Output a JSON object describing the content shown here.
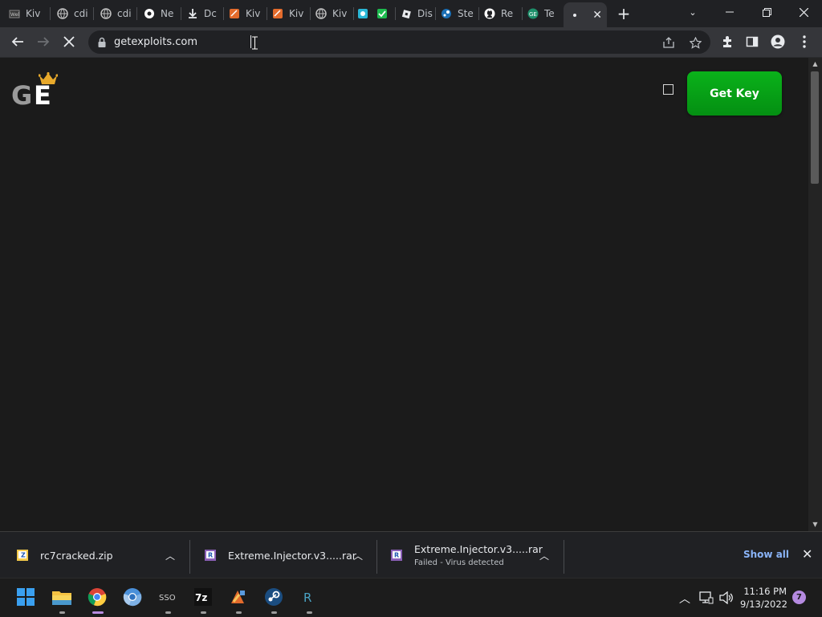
{
  "browser": {
    "tabs": [
      {
        "label": "Kiv",
        "icon": "roblox-icon"
      },
      {
        "label": "cdi",
        "icon": "globe-icon"
      },
      {
        "label": "cdi",
        "icon": "globe-icon"
      },
      {
        "label": "Ne",
        "icon": "chrome-icon"
      },
      {
        "label": "Dc",
        "icon": "download-icon"
      },
      {
        "label": "Kiv",
        "icon": "kiwi-icon"
      },
      {
        "label": "Kiv",
        "icon": "kiwi-icon"
      },
      {
        "label": "Kiv",
        "icon": "globe-icon"
      },
      {
        "label": "",
        "icon": "app-icon"
      },
      {
        "label": "",
        "icon": "check-icon"
      },
      {
        "label": "Dis",
        "icon": "roblox-icon"
      },
      {
        "label": "Ste",
        "icon": "steam-icon"
      },
      {
        "label": "Re",
        "icon": "github-icon"
      },
      {
        "label": "Te",
        "icon": "ge-icon"
      },
      {
        "label": "",
        "icon": "loading-icon",
        "active": true
      }
    ],
    "new_tab": "+",
    "url": "getexploits.com"
  },
  "page": {
    "logo_g": "G",
    "logo_e": "E",
    "get_key_label": "Get Key"
  },
  "downloads": {
    "items": [
      {
        "name": "rc7cracked.zip",
        "sub": "",
        "icon": "zip-icon"
      },
      {
        "name": "Extreme.Injector.v3.....rar",
        "sub": "",
        "icon": "rar-icon"
      },
      {
        "name": "Extreme.Injector.v3.....rar",
        "sub": "Failed - Virus detected",
        "icon": "rar-icon"
      }
    ],
    "show_all": "Show all"
  },
  "taskbar": {
    "time": "11:16 PM",
    "date": "9/13/2022",
    "notifications": "7",
    "apps": [
      "start",
      "file-explorer",
      "chrome",
      "chromium",
      "app",
      "7zip",
      "kiwi",
      "steam",
      "roblox-studio"
    ]
  }
}
